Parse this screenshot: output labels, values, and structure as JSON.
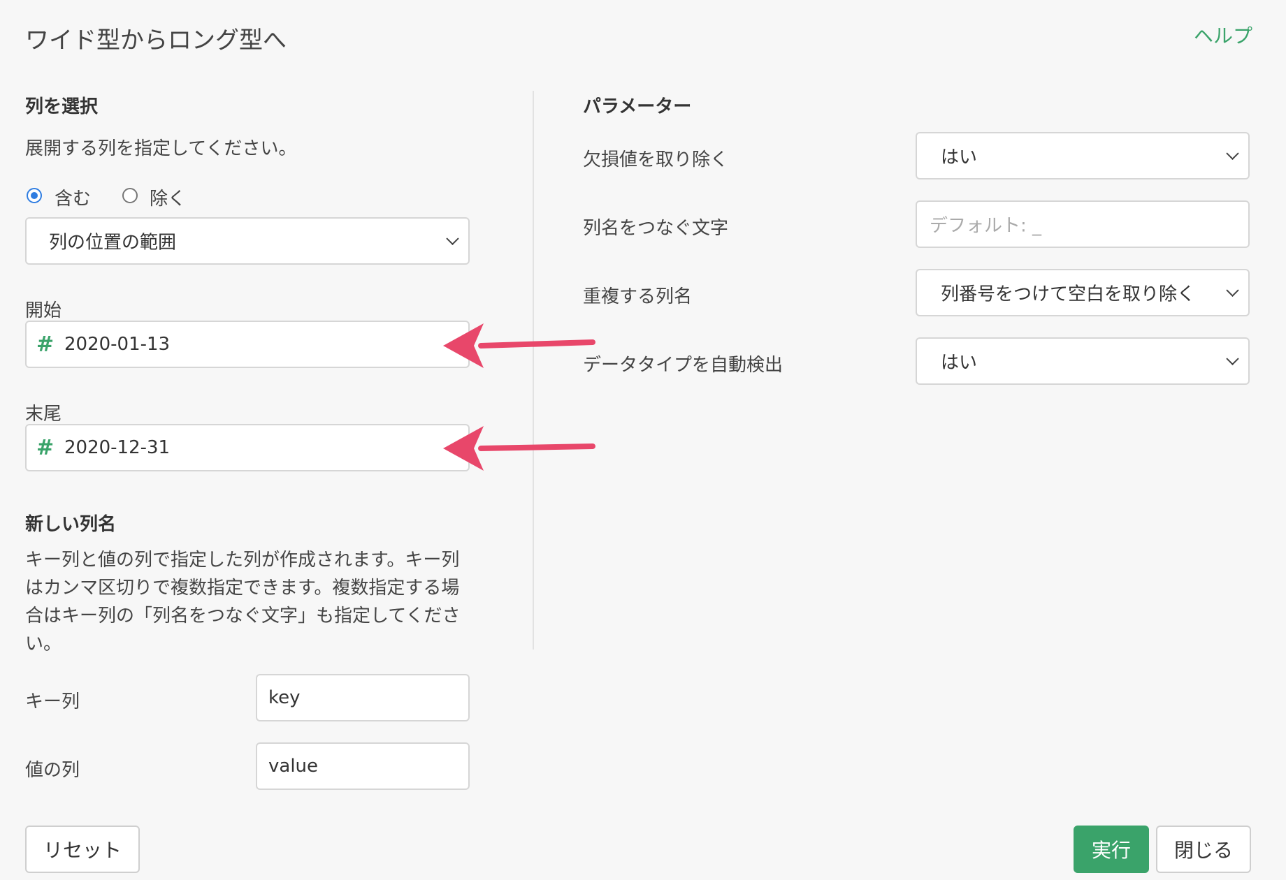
{
  "header": {
    "title": "ワイド型からロング型へ",
    "help_label": "ヘルプ"
  },
  "left": {
    "section_title": "列を選択",
    "instruction": "展開する列を指定してください。",
    "radio_include": "含む",
    "radio_exclude": "除く",
    "include_selected": true,
    "range_select": "列の位置の範囲",
    "start_label": "開始",
    "start_value": "2020-01-13",
    "end_label": "末尾",
    "end_value": "2020-12-31",
    "new_cols_title": "新しい列名",
    "new_cols_desc": "キー列と値の列で指定した列が作成されます。キー列はカンマ区切りで複数指定できます。複数指定する場合はキー列の「列名をつなぐ文字」も指定してください。",
    "key_label": "キー列",
    "key_value": "key",
    "value_label": "値の列",
    "value_value": "value"
  },
  "right": {
    "section_title": "パラメーター",
    "params": [
      {
        "label": "欠損値を取り除く",
        "value": "はい"
      },
      {
        "label": "列名をつなぐ文字",
        "placeholder": "デフォルト: _"
      },
      {
        "label": "重複する列名",
        "value": "列番号をつけて空白を取り除く"
      },
      {
        "label": "データタイプを自動検出",
        "value": "はい"
      }
    ]
  },
  "footer": {
    "reset": "リセット",
    "run": "実行",
    "close": "閉じる"
  },
  "colors": {
    "accent": "#3aa36a",
    "radio": "#2f7de1",
    "annotation_arrow": "#e8476a"
  }
}
